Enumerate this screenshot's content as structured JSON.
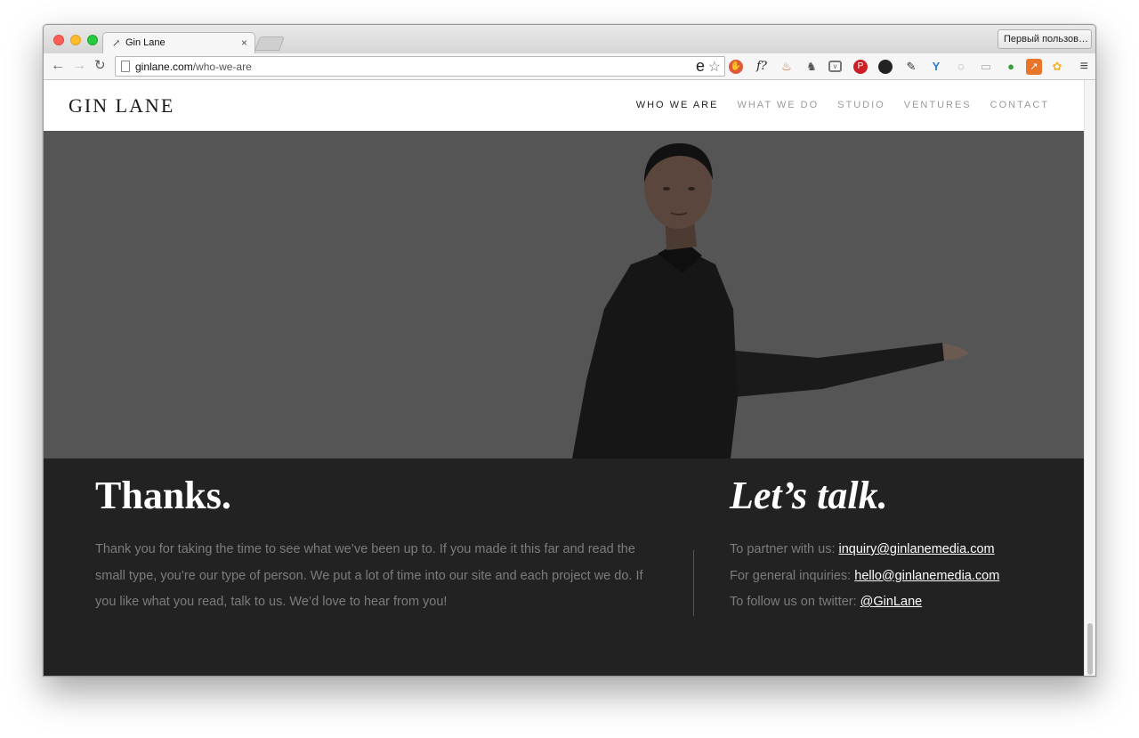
{
  "browser": {
    "tab_title": "Gin Lane",
    "tab_close": "×",
    "profile_button": "Первый пользов…",
    "url_domain": "ginlane.com",
    "url_path": "/who-we-are"
  },
  "site": {
    "logo": "GIN LANE",
    "nav": [
      {
        "label": "WHO WE ARE",
        "active": true
      },
      {
        "label": "WHAT WE DO",
        "active": false
      },
      {
        "label": "STUDIO",
        "active": false
      },
      {
        "label": "VENTURES",
        "active": false
      },
      {
        "label": "CONTACT",
        "active": false
      }
    ]
  },
  "footer": {
    "thanks_title": "Thanks.",
    "thanks_text": "Thank you for taking the time to see what we’ve been up to. If you made it this far and read the small type, you’re our type of person. We put a lot of time into our site and each project we do. If you like what you read, talk to us. We’d love to hear from you!",
    "talk_title": "Let’s talk.",
    "contacts": [
      {
        "label": "To partner with us: ",
        "link": "inquiry@ginlanemedia.com"
      },
      {
        "label": "For general inquiries: ",
        "link": "hello@ginlanemedia.com"
      },
      {
        "label": "To follow us on twitter: ",
        "link": "@GinLane"
      }
    ]
  },
  "colors": {
    "hero_bg": "#555555",
    "footer_bg": "#222222",
    "muted_text": "#7c7c7c"
  }
}
